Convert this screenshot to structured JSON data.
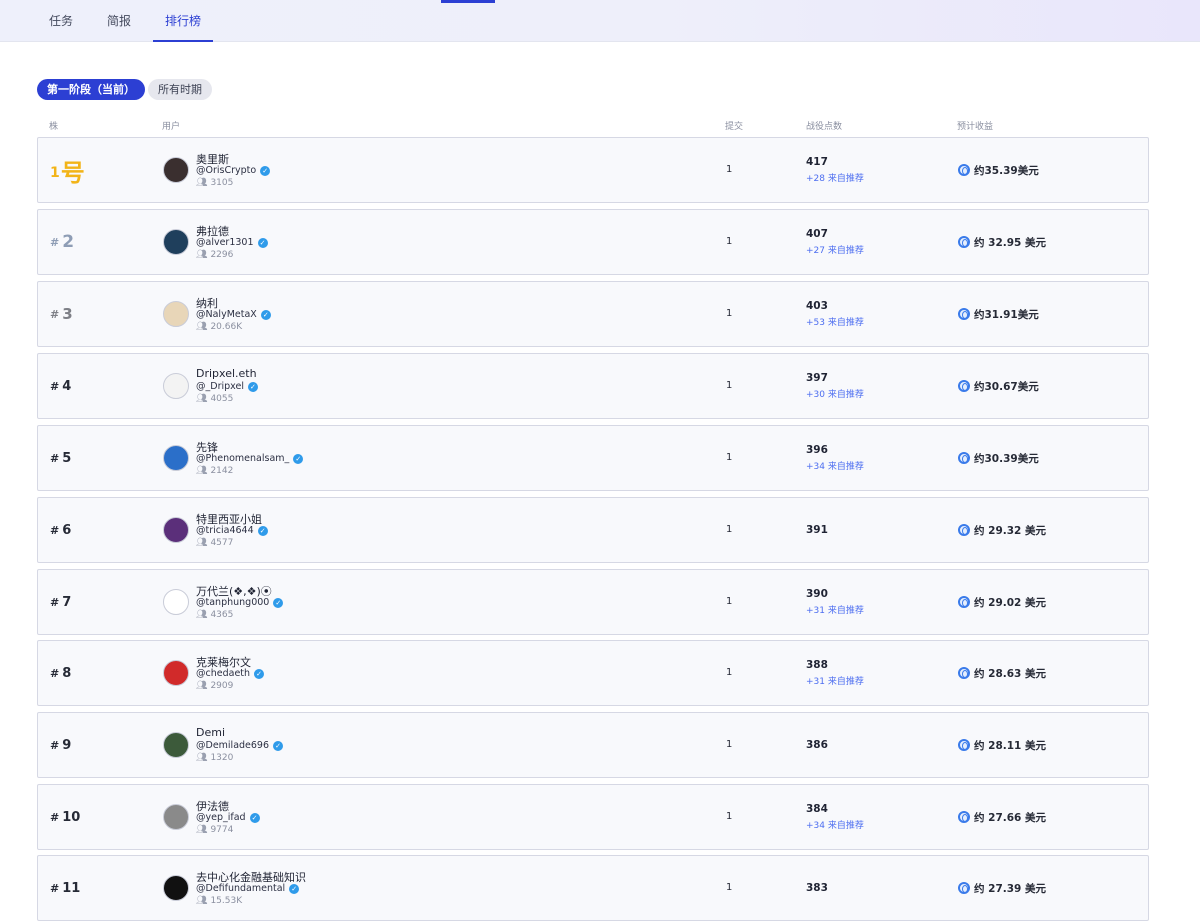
{
  "nav": {
    "tabs": [
      {
        "label": "任务",
        "active": false
      },
      {
        "label": "简报",
        "active": false
      },
      {
        "label": "排行榜",
        "active": true
      }
    ]
  },
  "filters": {
    "phase_current": "第一阶段（当前）",
    "all_time": "所有时期"
  },
  "table": {
    "headers": {
      "rank": "株",
      "user": "用户",
      "submits": "提交",
      "points": "战役点数",
      "reward": "预计收益"
    },
    "rows": [
      {
        "rank_hash": "",
        "rank_num": "1",
        "rank_suffix": "号",
        "name": "奥里斯",
        "handle": "@OrisCrypto",
        "followers": "3105",
        "submits": "1",
        "points": "417",
        "referral": "+28 来自推荐",
        "reward": "约35.39美元",
        "avatar_color": "#3a2f2f"
      },
      {
        "rank_hash": "#",
        "rank_num": "2",
        "rank_suffix": "",
        "name": "弗拉德",
        "handle": "@alver1301",
        "followers": "2296",
        "submits": "1",
        "points": "407",
        "referral": "+27 来自推荐",
        "reward": "约 32.95 美元",
        "avatar_color": "#1f3f5c"
      },
      {
        "rank_hash": "#",
        "rank_num": "3",
        "rank_suffix": "",
        "name": "纳利",
        "handle": "@NalyMetaX",
        "followers": "20.66K",
        "submits": "1",
        "points": "403",
        "referral": "+53 来自推荐",
        "reward": "约31.91美元",
        "avatar_color": "#e8d6b8"
      },
      {
        "rank_hash": "#",
        "rank_num": "4",
        "rank_suffix": "",
        "name": "Dripxel.eth",
        "handle": "@_Dripxel",
        "followers": "4055",
        "submits": "1",
        "points": "397",
        "referral": "+30 来自推荐",
        "reward": "约30.67美元",
        "avatar_color": "#f3f3f3"
      },
      {
        "rank_hash": "#",
        "rank_num": "5",
        "rank_suffix": "",
        "name": "先锋",
        "handle": "@Phenomenalsam_",
        "followers": "2142",
        "submits": "1",
        "points": "396",
        "referral": "+34 来自推荐",
        "reward": "约30.39美元",
        "avatar_color": "#2b6fc9"
      },
      {
        "rank_hash": "#",
        "rank_num": "6",
        "rank_suffix": "",
        "name": "特里西亚小姐",
        "handle": "@tricia4644",
        "followers": "4577",
        "submits": "1",
        "points": "391",
        "referral": "",
        "reward": "约 29.32 美元",
        "avatar_color": "#5b2f7a"
      },
      {
        "rank_hash": "#",
        "rank_num": "7",
        "rank_suffix": "",
        "name": "万代兰(❖,❖)⦿",
        "handle": "@tanphung000",
        "followers": "4365",
        "submits": "1",
        "points": "390",
        "referral": "+31 来自推荐",
        "reward": "约 29.02 美元",
        "avatar_color": "#ffffff"
      },
      {
        "rank_hash": "#",
        "rank_num": "8",
        "rank_suffix": "",
        "name": "克莱梅尔文",
        "handle": "@chedaeth",
        "followers": "2909",
        "submits": "1",
        "points": "388",
        "referral": "+31 来自推荐",
        "reward": "约 28.63 美元",
        "avatar_color": "#d12a2a"
      },
      {
        "rank_hash": "#",
        "rank_num": "9",
        "rank_suffix": "",
        "name": "Demi",
        "handle": "@Demilade696",
        "followers": "1320",
        "submits": "1",
        "points": "386",
        "referral": "",
        "reward": "约 28.11 美元",
        "avatar_color": "#3c5a3a"
      },
      {
        "rank_hash": "#",
        "rank_num": "10",
        "rank_suffix": "",
        "name": "伊法德",
        "handle": "@yep_ifad",
        "followers": "9774",
        "submits": "1",
        "points": "384",
        "referral": "+34 来自推荐",
        "reward": "约 27.66 美元",
        "avatar_color": "#8a8a8a"
      },
      {
        "rank_hash": "#",
        "rank_num": "11",
        "rank_suffix": "",
        "name": "去中心化金融基础知识",
        "handle": "@Defifundamental",
        "followers": "15.53K",
        "submits": "1",
        "points": "383",
        "referral": "",
        "reward": "约 27.39 美元",
        "avatar_color": "#111111"
      }
    ]
  }
}
